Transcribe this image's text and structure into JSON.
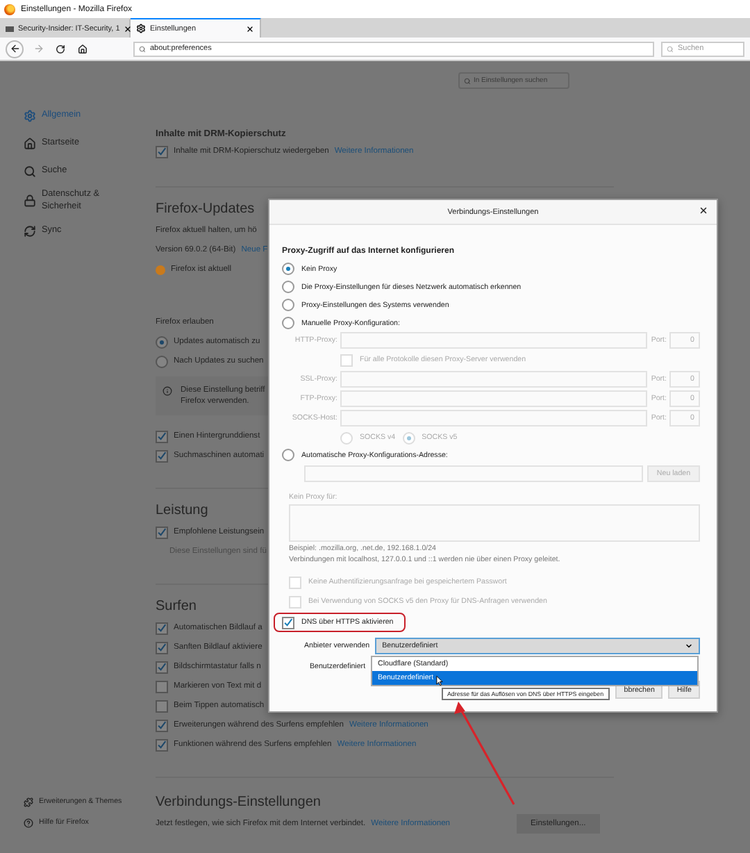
{
  "window": {
    "title": "Einstellungen - Mozilla Firefox"
  },
  "tabs": [
    {
      "label": "Security-Insider: IT-Security, 1",
      "selected": false
    },
    {
      "label": "Einstellungen",
      "selected": true
    }
  ],
  "toolbar": {
    "url": "about:preferences",
    "search_placeholder": "Suchen"
  },
  "sidebar": {
    "items": [
      {
        "label": "Allgemein",
        "selected": true
      },
      {
        "label": "Startseite",
        "selected": false
      },
      {
        "label": "Suche",
        "selected": false
      },
      {
        "label": "Datenschutz & Sicherheit",
        "selected": false
      },
      {
        "label": "Sync",
        "selected": false
      }
    ],
    "footer": [
      "Erweiterungen & Themes",
      "Hilfe für Firefox"
    ]
  },
  "preferences_search": {
    "placeholder": "In Einstellungen suchen"
  },
  "sections": [
    {
      "kind": "minor",
      "heading": "Inhalte mit DRM-Kopierschutz",
      "rows": [
        {
          "kind": "checkbox",
          "label": "Inhalte mit DRM-Kopierschutz wiedergeben",
          "checked": true,
          "link": "Weitere Informationen"
        }
      ]
    },
    {
      "kind": "major",
      "heading": "Firefox-Updates",
      "rows": [
        {
          "kind": "text",
          "text": "Firefox aktuell halten, um hö"
        },
        {
          "kind": "text",
          "text": "Version 69.0.2 (64-Bit)",
          "link": "Neue F"
        },
        {
          "kind": "status",
          "text": "Firefox ist aktuell"
        },
        {
          "kind": "label",
          "text": "Firefox erlauben"
        },
        {
          "kind": "radio",
          "label": "Updates automatisch zu",
          "selected": true
        },
        {
          "kind": "radio",
          "label": "Nach Updates zu suchen",
          "selected": false
        },
        {
          "kind": "info",
          "lines": [
            "Diese Einstellung betriff",
            "Firefox verwenden."
          ]
        },
        {
          "kind": "checkbox",
          "label": "Einen Hintergrunddienst",
          "checked": true
        },
        {
          "kind": "checkbox",
          "label": "Suchmaschinen automati",
          "checked": true
        }
      ]
    },
    {
      "kind": "major",
      "heading": "Leistung",
      "rows": [
        {
          "kind": "checkbox",
          "label": "Empfohlene Leistungsein",
          "checked": true
        },
        {
          "kind": "note",
          "text": "Diese Einstellungen sind fü"
        }
      ]
    },
    {
      "kind": "major",
      "heading": "Surfen",
      "rows": [
        {
          "kind": "checkbox",
          "label": "Automatischen Bildlauf a",
          "checked": true
        },
        {
          "kind": "checkbox",
          "label": "Sanften Bildlauf aktiviere",
          "checked": true
        },
        {
          "kind": "checkbox",
          "label": "Bildschirmtastatur falls n",
          "checked": true
        },
        {
          "kind": "checkbox",
          "label": "Markieren von Text mit d",
          "checked": false
        },
        {
          "kind": "checkbox",
          "label": "Beim Tippen automatisch",
          "checked": false
        },
        {
          "kind": "checkbox",
          "label": "Erweiterungen während des Surfens empfehlen",
          "checked": true,
          "link": "Weitere Informationen"
        },
        {
          "kind": "checkbox",
          "label": "Funktionen während des Surfens empfehlen",
          "checked": true,
          "link": "Weitere Informationen"
        }
      ]
    },
    {
      "kind": "major",
      "heading": "Verbindungs-Einstellungen",
      "rows": [
        {
          "kind": "text",
          "text": "Jetzt festlegen, wie sich Firefox mit dem Internet verbindet.",
          "link": "Weitere Informationen",
          "button": "Einstellungen..."
        }
      ]
    }
  ],
  "dialog": {
    "title": "Verbindungs-Einstellungen",
    "heading": "Proxy-Zugriff auf das Internet konfigurieren",
    "proxy_modes": [
      {
        "label": "Kein Proxy",
        "selected": true
      },
      {
        "label": "Die Proxy-Einstellungen für dieses Netzwerk automatisch erkennen",
        "selected": false
      },
      {
        "label": "Proxy-Einstellungen des Systems verwenden",
        "selected": false
      },
      {
        "label": "Manuelle Proxy-Konfiguration:",
        "selected": false
      }
    ],
    "manual_proxies": [
      {
        "label": "HTTP-Proxy:",
        "port_label": "Port:",
        "port": "0"
      },
      {
        "label": "SSL-Proxy:",
        "port_label": "Port:",
        "port": "0"
      },
      {
        "label": "FTP-Proxy:",
        "port_label": "Port:",
        "port": "0"
      },
      {
        "label": "SOCKS-Host:",
        "port_label": "Port:",
        "port": "0"
      }
    ],
    "share_proxy": {
      "label": "Für alle Protokolle diesen Proxy-Server verwenden",
      "checked": false
    },
    "socks_versions": [
      {
        "label": "SOCKS v4",
        "selected": false
      },
      {
        "label": "SOCKS v5",
        "selected": true
      }
    ],
    "auto_config": {
      "label": "Automatische Proxy-Konfigurations-Adresse:",
      "selected": false,
      "reload_button": "Neu laden"
    },
    "no_proxy": {
      "label": "Kein Proxy für:",
      "example": "Beispiel: .mozilla.org, .net.de, 192.168.1.0/24",
      "note": "Verbindungen mit localhost, 127.0.0.1 und ::1 werden nie über einen Proxy geleitet."
    },
    "options": [
      {
        "label": "Keine Authentifizierungsanfrage bei gespeichertem Passwort",
        "checked": false
      },
      {
        "label": "Bei Verwendung von SOCKS v5 den Proxy für DNS-Anfragen verwenden",
        "checked": false
      }
    ],
    "doh": {
      "label": "DNS über HTTPS aktivieren",
      "checked": true,
      "provider_label": "Anbieter verwenden",
      "provider_value": "Benutzerdefiniert",
      "custom_label": "Benutzerdefiniert",
      "provider_options": [
        {
          "label": "Cloudflare (Standard)",
          "selected": false
        },
        {
          "label": "Benutzerdefiniert",
          "selected": true
        }
      ]
    },
    "buttons": [
      "bbrechen",
      "Hilfe"
    ],
    "tooltip": "Adresse für das Auflösen von DNS über HTTPS eingeben"
  }
}
